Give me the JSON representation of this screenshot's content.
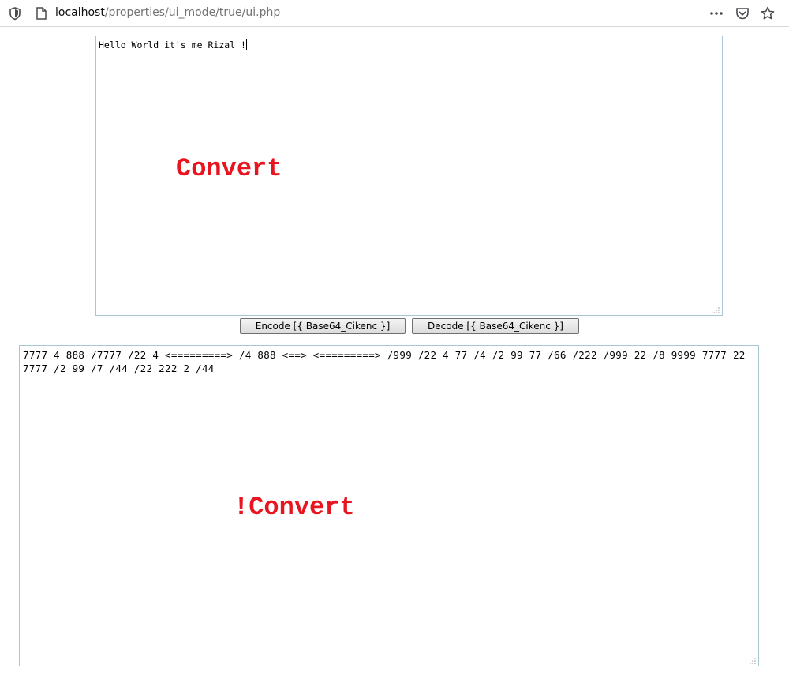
{
  "browser": {
    "url_host": "localhost",
    "url_path": "/properties/ui_mode/true/ui.php"
  },
  "input_area": {
    "value": "Hello World it's me Rizal !",
    "overlay_label": "Convert"
  },
  "buttons": {
    "encode_label": "Encode [{ Base64_Cikenc }]",
    "decode_label": "Decode [{ Base64_Cikenc }]"
  },
  "output_area": {
    "value": "7777 4 888 /7777 /22 4 <=========> /4 888 <==> <=========> /999 /22 4 77 /4 /2 99 77 /66 /222 /999 22 /8 9999 7777 22 7777 /2 99 /7 /44 /22 222 2 /44",
    "overlay_label": "!Convert"
  },
  "icons": {
    "shield": "shield-icon",
    "page": "page-icon",
    "more": "more-dots-icon",
    "pocket": "pocket-icon",
    "bookmark": "star-icon"
  },
  "colors": {
    "overlay_label": "#e8141f",
    "textarea_border": "#a9c6d4"
  }
}
